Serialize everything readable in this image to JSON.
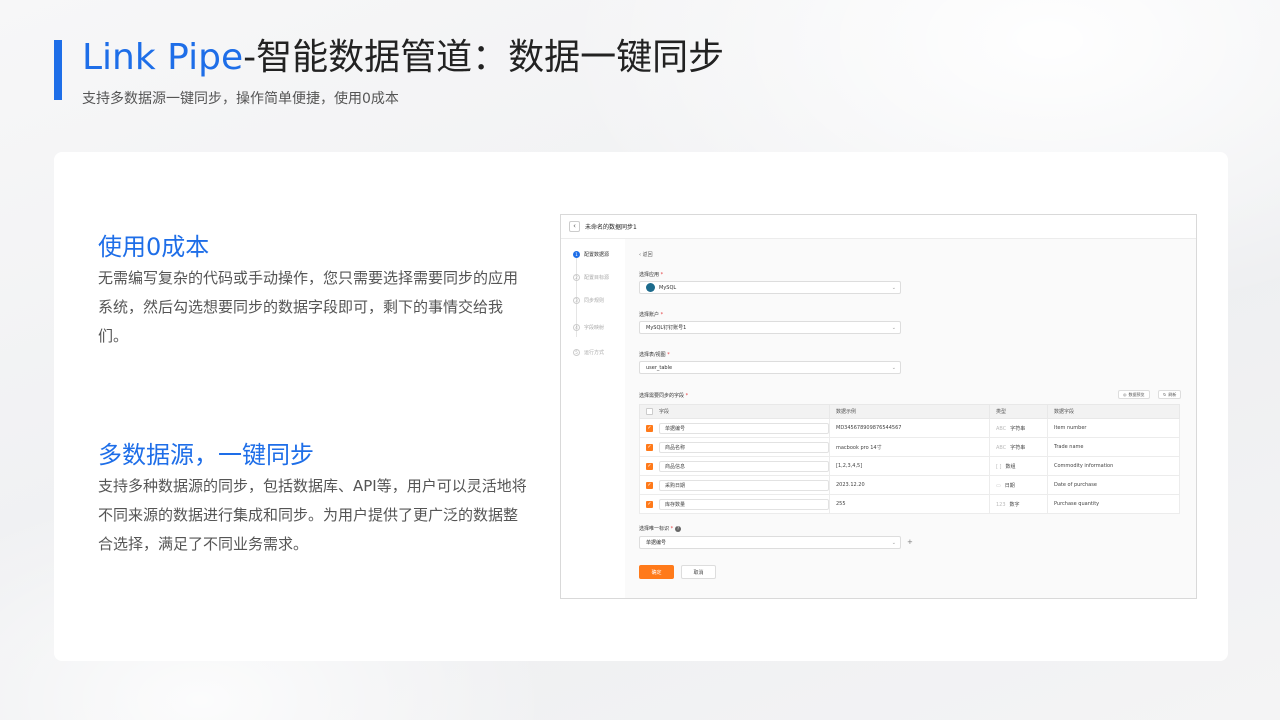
{
  "header": {
    "title_brand": "Link Pipe",
    "title_rest": "-智能数据管道：数据一键同步",
    "subtitle": "支持多数据源一键同步，操作简单便捷，使用0成本"
  },
  "features": [
    {
      "title": "使用0成本",
      "text": "无需编写复杂的代码或手动操作，您只需要选择需要同步的应用系统，然后勾选想要同步的数据字段即可，剩下的事情交给我们。"
    },
    {
      "title": "多数据源，一键同步",
      "text": "支持多种数据源的同步，包括数据库、API等，用户可以灵活地将不同来源的数据进行集成和同步。为用户提供了更广泛的数据整合选择，满足了不同业务需求。"
    }
  ],
  "screenshot": {
    "window_title": "未命名的数据同步1",
    "back_icon": "‹",
    "steps": [
      "配置数据源",
      "配置目标源",
      "同步规则",
      "字段映射",
      "运行方式"
    ],
    "back_link": "‹ 返回",
    "app_label": "选择应用",
    "app_value": "MySQL",
    "account_label": "选择账户",
    "account_value": "MySQL钉钉账号1",
    "table_label": "选择表/视图",
    "table_value": "user_table",
    "fields_label": "选择需要同步的字段",
    "preview_button": "数据预览",
    "refresh_button": "刷新",
    "columns": [
      "字段",
      "数据示例",
      "类型",
      "数据字段"
    ],
    "rows": [
      {
        "field": "单据编号",
        "example": "MD345678909876544567",
        "type_icon": "ABC",
        "type": "字符串",
        "target": "Item number"
      },
      {
        "field": "商品名称",
        "example": "macbook pro 14寸",
        "type_icon": "ABC",
        "type": "字符串",
        "target": "Trade name"
      },
      {
        "field": "商品信息",
        "example": "[1,2,3,4,5]",
        "type_icon": "[ ]",
        "type": "数组",
        "target": "Commodity information"
      },
      {
        "field": "采购日期",
        "example": "2023.12.20",
        "type_icon": "▭",
        "type": "日期",
        "target": "Date of purchase"
      },
      {
        "field": "库存数量",
        "example": "255",
        "type_icon": "123",
        "type": "数字",
        "target": "Purchase quantity"
      }
    ],
    "unique_label": "选择唯一标识",
    "unique_value": "单据编号",
    "add_symbol": "+",
    "ok_button": "确定",
    "cancel_button": "取消"
  },
  "colors": {
    "accent": "#1e6ee8",
    "action": "#ff7a1a"
  }
}
